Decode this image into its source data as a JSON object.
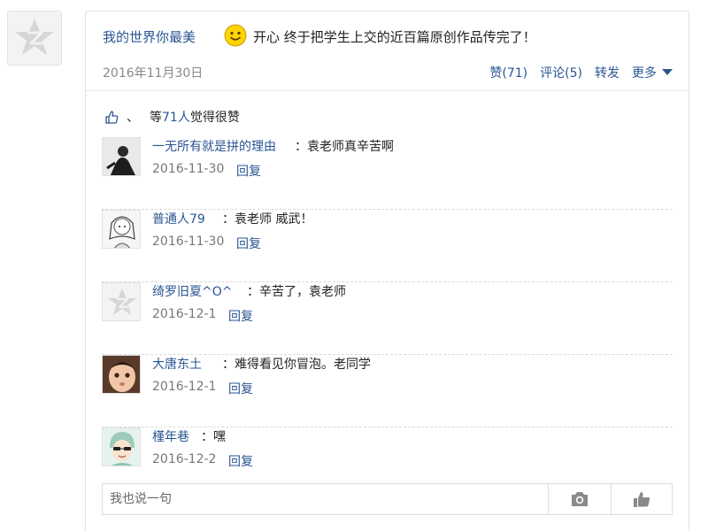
{
  "post": {
    "author": "我的世界你最美",
    "emoji_icon": "smiley-face-icon",
    "text": "开心 终于把学生上交的近百篇原创作品传完了！",
    "date": "2016年11月30日",
    "actions": {
      "like": "赞(71)",
      "comment": "评论(5)",
      "share": "转发",
      "more": "更多"
    }
  },
  "likes": {
    "separator": "、",
    "prefix": "等",
    "count": "71人",
    "suffix": "觉得很赞"
  },
  "comments": [
    {
      "name": "一无所有就是拼的理由",
      "text": "：袁老师真辛苦啊",
      "date": "2016-11-30",
      "reply": "回复",
      "avatar": "dark-photo-avatar"
    },
    {
      "name": "普通人79",
      "text": "：袁老师 威武！",
      "date": "2016-11-30",
      "reply": "回复",
      "avatar": "sketch-avatar"
    },
    {
      "name": "绮罗旧夏^O^",
      "text": "：辛苦了，袁老师",
      "date": "2016-12-1",
      "reply": "回复",
      "avatar": "default-avatar"
    },
    {
      "name": "大唐东土",
      "text": "：难得看见你冒泡。老同学",
      "date": "2016-12-1",
      "reply": "回复",
      "avatar": "baby-photo-avatar"
    },
    {
      "name": "槿年巷",
      "text": "：嘿",
      "date": "2016-12-2",
      "reply": "回复",
      "avatar": "cartoon-avatar"
    }
  ],
  "reply_box": {
    "placeholder": "我也说一句",
    "camera_icon": "camera-icon",
    "like_icon": "thumbs-up-icon"
  },
  "colors": {
    "link": "#2a5593",
    "border": "#e0e0e0",
    "muted": "#888888"
  }
}
